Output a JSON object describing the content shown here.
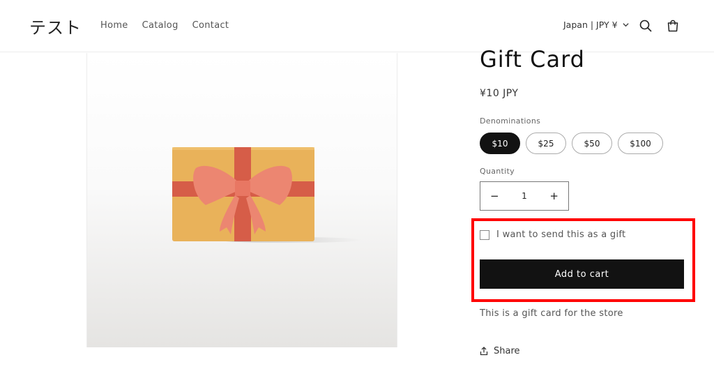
{
  "header": {
    "logo": "テスト",
    "nav": [
      "Home",
      "Catalog",
      "Contact"
    ],
    "locale": "Japan | JPY ¥"
  },
  "product": {
    "title": "Gift Card",
    "price": "¥10 JPY",
    "denominations_label": "Denominations",
    "denominations": [
      "$10",
      "$25",
      "$50",
      "$100"
    ],
    "selected_denomination": "$10",
    "quantity_label": "Quantity",
    "quantity_minus": "−",
    "quantity_value": "1",
    "quantity_plus": "+",
    "gift_label": "I want to send this as a gift",
    "add_to_cart": "Add to cart",
    "description": "This is a gift card for the store",
    "share": "Share"
  },
  "colors": {
    "accent": "#121212",
    "highlight": "#ff0000",
    "card": "#e9b25a",
    "ribbon": "#d65d48",
    "bow": "#ec8671"
  },
  "icons": [
    "chevron-down-icon",
    "search-icon",
    "cart-icon",
    "share-icon"
  ]
}
